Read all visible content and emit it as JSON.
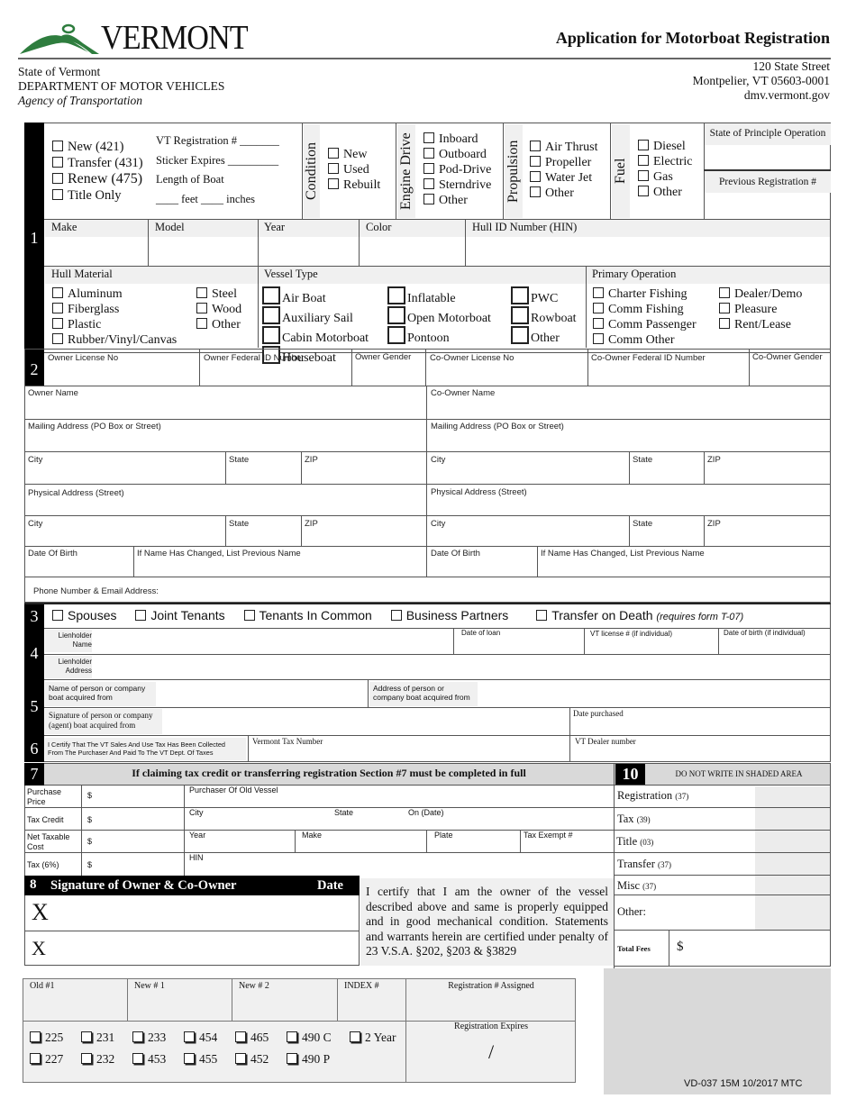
{
  "header": {
    "logo_text": "VERMONT",
    "form_title": "Application for Motorboat Registration",
    "agency": {
      "line1": "State of Vermont",
      "line2": "DEPARTMENT OF MOTOR VEHICLES",
      "line3": "Agency of Transportation"
    },
    "address": {
      "street": "120 State Street",
      "city": "Montpelier, VT 05603-0001",
      "web": "dmv.vermont.gov"
    }
  },
  "section1": {
    "number": "1",
    "transaction_types": [
      "New (421)",
      "Transfer (431)",
      "Renew (475)",
      "Title Only"
    ],
    "reg_fields": {
      "vt_registration": "VT Registration # _______",
      "sticker_expires": "Sticker Expires _________",
      "length": "Length of Boat",
      "feet_inches": "____ feet ____ inches"
    },
    "condition": {
      "label": "Condition",
      "options": [
        "New",
        "Used",
        "Rebuilt"
      ]
    },
    "engine_drive": {
      "label": "Engine Drive",
      "options": [
        "Inboard",
        "Outboard",
        "Pod-Drive",
        "Sterndrive",
        "Other"
      ]
    },
    "propulsion": {
      "label": "Propulsion",
      "options": [
        "Air Thrust",
        "Propeller",
        "Water Jet",
        "Other"
      ]
    },
    "fuel": {
      "label": "Fuel",
      "options": [
        "Diesel",
        "Electric",
        "Gas",
        "Other"
      ]
    },
    "state_principle": "State of Principle Operation",
    "previous_registration": "Previous Registration #",
    "vessel_fields": [
      "Make",
      "Model",
      "Year",
      "Color",
      "Hull ID Number (HIN)"
    ],
    "hull_material": {
      "label": "Hull Material",
      "col1": [
        "Aluminum",
        "Fiberglass",
        "Plastic",
        "Rubber/Vinyl/Canvas"
      ],
      "col2": [
        "Steel",
        "Wood",
        "Other"
      ]
    },
    "vessel_type": {
      "label": "Vessel Type",
      "col1": [
        "Air Boat",
        "Auxiliary Sail",
        "Cabin Motorboat",
        "Houseboat"
      ],
      "col2": [
        "Inflatable",
        "Open Motorboat",
        "Pontoon"
      ],
      "col3": [
        "PWC",
        "Rowboat",
        "Other"
      ]
    },
    "primary_operation": {
      "label": "Primary Operation",
      "col1": [
        "Charter Fishing",
        "Comm Fishing",
        "Comm Passenger",
        "Comm Other"
      ],
      "col2": [
        "Dealer/Demo",
        "Pleasure",
        "Rent/Lease"
      ]
    }
  },
  "section2": {
    "number": "2",
    "id_fields": [
      "Owner License No",
      "Owner Federal ID Number",
      "Owner Gender",
      "Co-Owner License No",
      "Co-Owner Federal ID Number",
      "Co-Owner Gender"
    ],
    "owner": {
      "name": "Owner Name",
      "mailing": "Mailing Address (PO Box or Street)",
      "city": "City",
      "state": "State",
      "zip": "ZIP",
      "physical": "Physical Address (Street)",
      "dob": "Date Of Birth",
      "prev_name": "If Name Has Changed, List Previous Name"
    },
    "coowner": {
      "name": "Co-Owner Name",
      "mailing": "Mailing Address (PO Box or Street)",
      "city": "City",
      "state": "State",
      "zip": "ZIP",
      "physical": "Physical Address (Street)",
      "dob": "Date Of Birth",
      "prev_name": "If Name Has Changed, List Previous Name"
    },
    "phone_email": "Phone Number & Email Address:"
  },
  "section3": {
    "number": "3",
    "options": [
      "Spouses",
      "Joint Tenants",
      "Tenants In Common",
      "Business Partners",
      "Transfer on Death"
    ],
    "tod_note": "(requires form T-07)"
  },
  "section4": {
    "number": "4",
    "lienholder_name": [
      "Lienholder",
      "Name"
    ],
    "lienholder_address": [
      "Lienholder",
      "Address"
    ],
    "date_of_loan": "Date of loan",
    "vt_license": "VT license # (if individual)",
    "dob": "Date of birth (if individual)"
  },
  "section5": {
    "number": "5",
    "name_from": [
      "Name of person or company",
      "boat acquired from"
    ],
    "address_from": [
      "Address of person or",
      "company boat acquired from"
    ],
    "signature_from": [
      "Signature of person or company",
      "(agent) boat acquired from"
    ],
    "date_purchased": "Date purchased"
  },
  "section6": {
    "number": "6",
    "certify": [
      "I Certify That The VT Sales And Use Tax Has Been Collected",
      "From The Purchaser And Paid To The VT Dept. Of Taxes"
    ],
    "tax_number": "Vermont Tax Number",
    "dealer_number": "VT Dealer number"
  },
  "section7": {
    "number": "7",
    "title": "If claiming tax credit or transferring registration Section #7 must be completed in full",
    "rows": [
      {
        "label": "Purchase Price",
        "dollar": "$"
      },
      {
        "label": "Tax Credit",
        "dollar": "$"
      },
      {
        "label": "Net Taxable Cost",
        "dollar": "$"
      },
      {
        "label": "Tax (6%)",
        "dollar": "$"
      }
    ],
    "purchaser_old": "Purchaser Of Old Vessel",
    "city": "City",
    "state": "State",
    "on_date": "On (Date)",
    "year": "Year",
    "make": "Make",
    "plate": "Plate",
    "tax_exempt": "Tax Exempt #",
    "hin": "HIN"
  },
  "section8": {
    "number": "8",
    "title": "Signature of Owner & Co-Owner",
    "date": "Date",
    "x_mark": "X",
    "certification": "I certify that I am the owner of the vessel described above and same is properly equipped and in good mechanical condition. Statements and warrants herein are certified under penalty of 23 V.S.A. §202, §203 & §3829"
  },
  "section10": {
    "number": "10",
    "note": "DO NOT WRITE IN SHADED AREA",
    "fees": [
      {
        "label": "Registration",
        "code": "(37)"
      },
      {
        "label": "Tax",
        "code": "(39)"
      },
      {
        "label": "Title",
        "code": "(03)"
      },
      {
        "label": "Transfer",
        "code": "(37)"
      },
      {
        "label": "Misc",
        "code": "(37)"
      },
      {
        "label": "Other:",
        "code": ""
      }
    ],
    "total_label": "Total Fees",
    "total_dollar": "$"
  },
  "office_use": {
    "fields": [
      "Old #1",
      "New # 1",
      "New # 2",
      "INDEX #"
    ],
    "reg_assigned": "Registration # Assigned",
    "reg_expires": "Registration Expires",
    "slash": "/",
    "codes_row1": [
      "225",
      "231",
      "233",
      "454",
      "465",
      "490 C",
      "2 Year"
    ],
    "codes_row2": [
      "227",
      "232",
      "453",
      "455",
      "452",
      "490 P"
    ]
  },
  "footer": {
    "form_id": "VD-037 15M 10/2017 MTC"
  },
  "colors": {
    "logo_green": "#2e7d3e",
    "shade": "#f0f0f0",
    "dark_shade": "#d9d9d9"
  }
}
